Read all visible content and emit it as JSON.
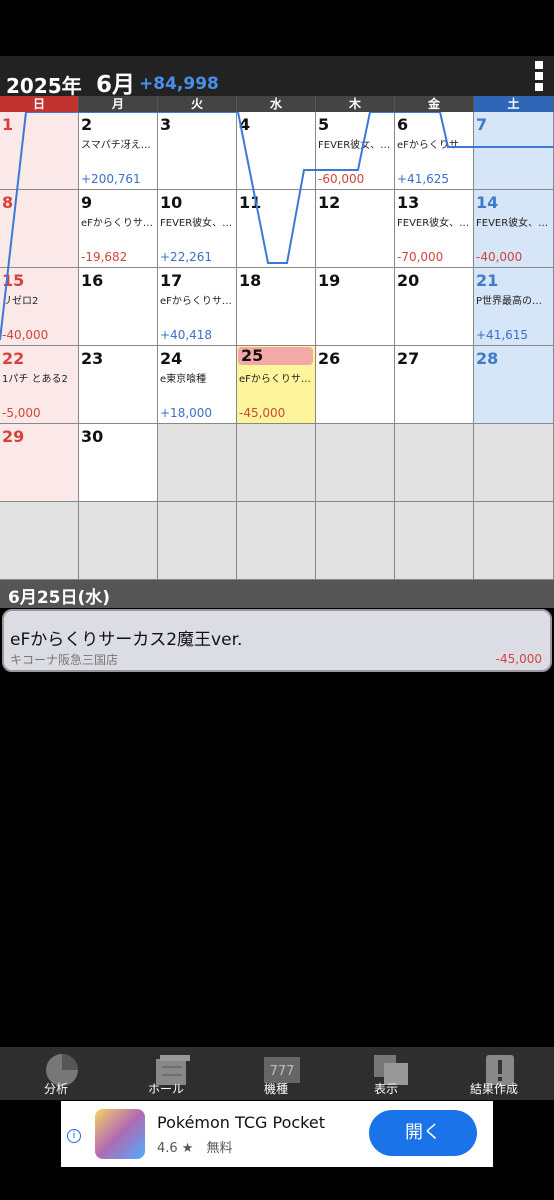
{
  "header": {
    "year": "2025年",
    "month": "6月",
    "total": "+84,998"
  },
  "weekdays": [
    "日",
    "月",
    "火",
    "水",
    "木",
    "金",
    "土"
  ],
  "weekday_colors": [
    "#c0332e",
    "#444444",
    "#444444",
    "#444444",
    "#444444",
    "#444444",
    "#2f66b5"
  ],
  "days": [
    {
      "day": "1",
      "machine": "",
      "amount": "",
      "sign": ""
    },
    {
      "day": "2",
      "machine": "スマパチ冴え…",
      "amount": "+200,761",
      "sign": "plus"
    },
    {
      "day": "3",
      "machine": "",
      "amount": "",
      "sign": ""
    },
    {
      "day": "4",
      "machine": "",
      "amount": "",
      "sign": ""
    },
    {
      "day": "5",
      "machine": "FEVER彼女、…",
      "amount": "-60,000",
      "sign": "minus"
    },
    {
      "day": "6",
      "machine": "eFからくりサ…",
      "amount": "+41,625",
      "sign": "plus"
    },
    {
      "day": "7",
      "machine": "",
      "amount": "",
      "sign": ""
    },
    {
      "day": "8",
      "machine": "",
      "amount": "",
      "sign": ""
    },
    {
      "day": "9",
      "machine": "eFからくりサ…",
      "amount": "-19,682",
      "sign": "minus"
    },
    {
      "day": "10",
      "machine": "FEVER彼女、…",
      "amount": "+22,261",
      "sign": "plus"
    },
    {
      "day": "11",
      "machine": "",
      "amount": "",
      "sign": ""
    },
    {
      "day": "12",
      "machine": "",
      "amount": "",
      "sign": ""
    },
    {
      "day": "13",
      "machine": "FEVER彼女、…",
      "amount": "-70,000",
      "sign": "minus"
    },
    {
      "day": "14",
      "machine": "FEVER彼女、…",
      "amount": "-40,000",
      "sign": "minus"
    },
    {
      "day": "15",
      "machine": "リゼロ2",
      "amount": "-40,000",
      "sign": "minus"
    },
    {
      "day": "16",
      "machine": "",
      "amount": "",
      "sign": ""
    },
    {
      "day": "17",
      "machine": "eFからくりサ…",
      "amount": "+40,418",
      "sign": "plus"
    },
    {
      "day": "18",
      "machine": "",
      "amount": "",
      "sign": ""
    },
    {
      "day": "19",
      "machine": "",
      "amount": "",
      "sign": ""
    },
    {
      "day": "20",
      "machine": "",
      "amount": "",
      "sign": ""
    },
    {
      "day": "21",
      "machine": "P世界最高の…",
      "amount": "+41,615",
      "sign": "plus"
    },
    {
      "day": "22",
      "machine": "1パチ とある2",
      "amount": "-5,000",
      "sign": "minus"
    },
    {
      "day": "23",
      "machine": "",
      "amount": "",
      "sign": ""
    },
    {
      "day": "24",
      "machine": "e東京喰種",
      "amount": "+18,000",
      "sign": "plus"
    },
    {
      "day": "25",
      "machine": "eFからくりサ…",
      "amount": "-45,000",
      "sign": "minus"
    },
    {
      "day": "26",
      "machine": "",
      "amount": "",
      "sign": ""
    },
    {
      "day": "27",
      "machine": "",
      "amount": "",
      "sign": ""
    },
    {
      "day": "28",
      "machine": "",
      "amount": "",
      "sign": ""
    },
    {
      "day": "29",
      "machine": "",
      "amount": "",
      "sign": ""
    },
    {
      "day": "30",
      "machine": "",
      "amount": "",
      "sign": ""
    }
  ],
  "selected": {
    "date_label": "6月25日(水)",
    "machine": "eFからくりサーカス2魔王ver.",
    "store": "キコーナ阪急三国店",
    "amount": "-45,000"
  },
  "toolbar": [
    {
      "label": "分析",
      "icon": "pie-chart-icon"
    },
    {
      "label": "ホール",
      "icon": "building-icon"
    },
    {
      "label": "機種",
      "icon": "slot-777-icon"
    },
    {
      "label": "表示",
      "icon": "overlapping-squares-icon"
    },
    {
      "label": "結果作成",
      "icon": "exclamation-icon"
    }
  ],
  "ad": {
    "app_name": "Pokémon TCG Pocket",
    "rating": "4.6 ★",
    "price": "無料",
    "button": "開く"
  },
  "colors": {
    "plus": "#3c6fc7",
    "minus": "#d0463c",
    "graph": "#3c78d8",
    "today": "#fdf59c"
  }
}
